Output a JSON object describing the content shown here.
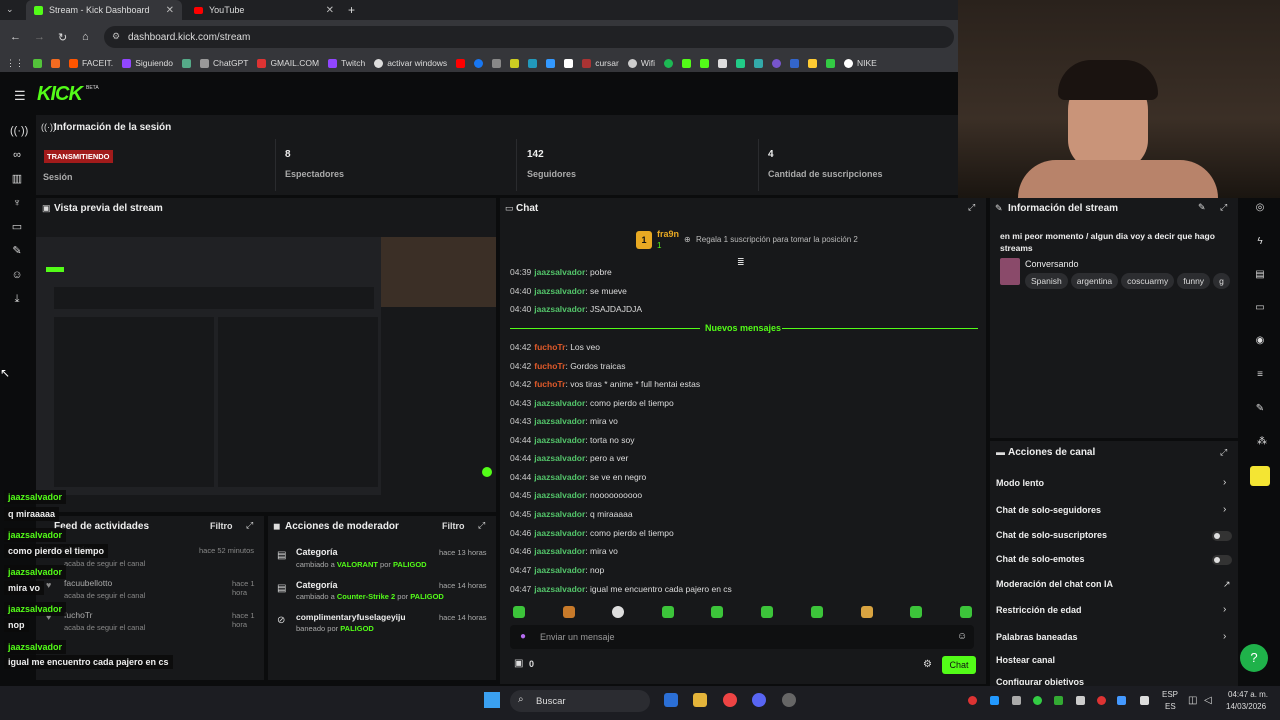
{
  "browser": {
    "tabs": [
      {
        "title": "Stream - Kick Dashboard",
        "active": true
      },
      {
        "title": "YouTube",
        "active": false
      }
    ],
    "url": "dashboard.kick.com/stream",
    "bookmarks": [
      "FACEIT.",
      "Siguiendo",
      "ChatGPT",
      "GMAIL.COM",
      "Twitch",
      "activar windows",
      "cursar",
      "Wifi",
      "NIKE"
    ]
  },
  "kick": {
    "logo": "KICK",
    "beta": "BETA"
  },
  "session": {
    "title": "Información de la sesión",
    "live_badge": "TRANSMITIENDO",
    "session_label": "Sesión",
    "stats": [
      {
        "value": "8",
        "label": "Espectadores"
      },
      {
        "value": "142",
        "label": "Seguidores"
      },
      {
        "value": "4",
        "label": "Cantidad de suscripciones"
      }
    ]
  },
  "preview": {
    "title": "Vista previa del stream"
  },
  "activity": {
    "title": "Feed de actividades",
    "filter": "Filtro",
    "items": [
      {
        "user": "jaazsalvador",
        "time": "hace 52 minutos",
        "desc": "acaba de seguir el canal"
      },
      {
        "user": "facuubellotto",
        "time": "hace 1 hora",
        "desc": "acaba de seguir el canal"
      },
      {
        "user": "fuchoTr",
        "time": "hace 1 hora",
        "desc": "acaba de seguir el canal"
      }
    ]
  },
  "mod": {
    "title": "Acciones de moderador",
    "filter": "Filtro",
    "items": [
      {
        "title": "Categoría",
        "time": "hace 13 horas",
        "pre": "cambiado a ",
        "val": "VALORANT",
        "mid": " por ",
        "by": "PALIGOD"
      },
      {
        "title": "Categoría",
        "time": "hace 14 horas",
        "pre": "cambiado a ",
        "val": "Counter-Strike 2",
        "mid": " por ",
        "by": "PALIGOD"
      },
      {
        "title": "complimentaryfuselageyiju",
        "time": "hace 14 horas",
        "pre": "baneado por ",
        "val": "",
        "mid": "",
        "by": "PALIGOD"
      }
    ]
  },
  "chat": {
    "title": "Chat",
    "top_user": "fra9n",
    "top_rank": "1",
    "promo": "Regala 1 suscripción para tomar la posición 2",
    "new_messages": "Nuevos mensajes",
    "messages": [
      {
        "time": "04:39",
        "user": "jaazsalvador",
        "text": "pobre",
        "orange": false
      },
      {
        "time": "04:40",
        "user": "jaazsalvador",
        "text": "se mueve",
        "orange": false
      },
      {
        "time": "04:40",
        "user": "jaazsalvador",
        "text": "JSAJDAJDJA",
        "orange": false
      },
      {
        "time": "04:42",
        "user": "fuchoTr",
        "text": "Los veo",
        "orange": true
      },
      {
        "time": "04:42",
        "user": "fuchoTr",
        "text": "Gordos traicas",
        "orange": true
      },
      {
        "time": "04:42",
        "user": "fuchoTr",
        "text": "vos tiras * anime * full hentai estas",
        "orange": true
      },
      {
        "time": "04:43",
        "user": "jaazsalvador",
        "text": "como pierdo el tiempo",
        "orange": false
      },
      {
        "time": "04:43",
        "user": "jaazsalvador",
        "text": "mira vo",
        "orange": false
      },
      {
        "time": "04:44",
        "user": "jaazsalvador",
        "text": "torta no soy",
        "orange": false
      },
      {
        "time": "04:44",
        "user": "jaazsalvador",
        "text": "pero a ver",
        "orange": false
      },
      {
        "time": "04:44",
        "user": "jaazsalvador",
        "text": "se ve en negro",
        "orange": false
      },
      {
        "time": "04:45",
        "user": "jaazsalvador",
        "text": "noooooooooo",
        "orange": false
      },
      {
        "time": "04:45",
        "user": "jaazsalvador",
        "text": "q miraaaaa",
        "orange": false
      },
      {
        "time": "04:46",
        "user": "jaazsalvador",
        "text": "como pierdo el tiempo",
        "orange": false
      },
      {
        "time": "04:46",
        "user": "jaazsalvador",
        "text": "mira vo",
        "orange": false
      },
      {
        "time": "04:47",
        "user": "jaazsalvador",
        "text": "nop",
        "orange": false
      },
      {
        "time": "04:47",
        "user": "jaazsalvador",
        "text": "igual me encuentro cada pajero en cs",
        "orange": false
      }
    ],
    "input_placeholder": "Enviar un mensaje",
    "points": "0",
    "send_label": "Chat"
  },
  "stream_info": {
    "title": "Información del stream",
    "stream_title": "en mi peor momento / algun dia voy a decir que hago streams",
    "category": "Conversando",
    "tags": [
      "Spanish",
      "argentina",
      "coscuarmy",
      "funny",
      "g"
    ]
  },
  "channel_actions": {
    "title": "Acciones de canal",
    "items": [
      "Modo lento",
      "Chat de solo-seguidores",
      "Chat de solo-suscriptores",
      "Chat de solo-emotes",
      "Moderación del chat con IA",
      "Restricción de edad",
      "Palabras baneadas",
      "Hostear canal",
      "Configurar objetivos"
    ]
  },
  "overlay": [
    {
      "user": "jaazsalvador",
      "text": "q miraaaaa"
    },
    {
      "user": "jaazsalvador",
      "text": "como pierdo el tiempo"
    },
    {
      "user": "jaazsalvador",
      "text": "mira vo"
    },
    {
      "user": "jaazsalvador",
      "text": "nop"
    },
    {
      "user": "jaazsalvador",
      "text": "igual me encuentro cada pajero en cs"
    }
  ],
  "taskbar": {
    "search": "Buscar",
    "lang_top": "ESP",
    "lang_bottom": "ES",
    "time": "04:47 a. m.",
    "date": "14/03/2026"
  }
}
